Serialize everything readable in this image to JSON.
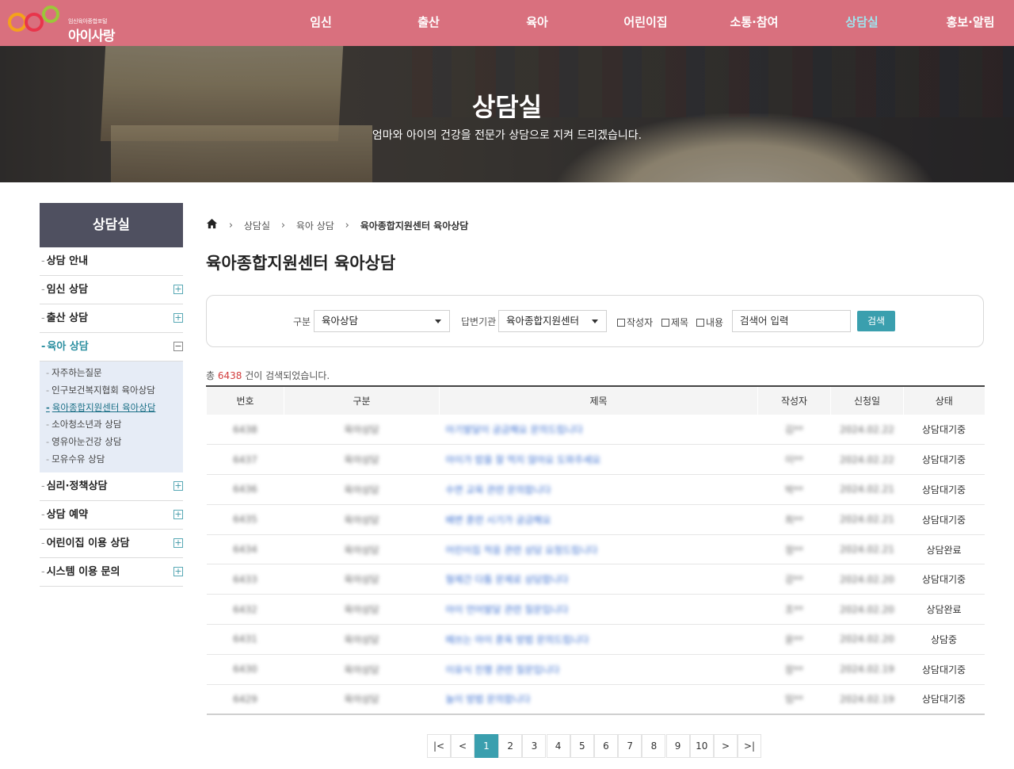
{
  "logo": {
    "sub": "임신육아종합포털",
    "main": "아이사랑"
  },
  "nav": [
    "임신",
    "출산",
    "육아",
    "어린이집",
    "소통·참여",
    "상담실",
    "홍보·알림"
  ],
  "hero": {
    "title": "상담실",
    "subtitle": "엄마와 아이의 건강을 전문가 상담으로 지켜 드리겠습니다."
  },
  "sidebar": {
    "title": "상담실",
    "items": [
      {
        "label": "상담 안내",
        "toggle": ""
      },
      {
        "label": "임신 상담",
        "toggle": "+"
      },
      {
        "label": "출산 상담",
        "toggle": "+"
      },
      {
        "label": "육아 상담",
        "toggle": "−"
      },
      {
        "label": "심리·정책상담",
        "toggle": "+"
      },
      {
        "label": "상담 예약",
        "toggle": "+"
      },
      {
        "label": "어린이집 이용 상담",
        "toggle": "+"
      },
      {
        "label": "시스템 이용 문의",
        "toggle": "+"
      }
    ],
    "sub_items": [
      "자주하는질문",
      "인구보건복지협회 육아상담",
      "육아종합지원센터 육아상담",
      "소아청소년과 상담",
      "영유아눈건강 상담",
      "모유수유 상담"
    ]
  },
  "breadcrumb": {
    "level1": "상담실",
    "level2": "육아 상담",
    "current": "육아종합지원센터 육아상담"
  },
  "page_title": "육아종합지원센터 육아상담",
  "search": {
    "category_label": "구분",
    "category_value": "육아상담",
    "agency_label": "답변기관",
    "agency_value": "육아종합지원센터",
    "checkbox_writer": "작성자",
    "checkbox_title": "제목",
    "checkbox_content": "내용",
    "keyword_placeholder": "검색어 입력",
    "button": "검색"
  },
  "result": {
    "prefix": "총",
    "count": "6438",
    "suffix": "건이 검색되었습니다."
  },
  "table": {
    "headers": [
      "번호",
      "구분",
      "제목",
      "작성자",
      "신청일",
      "상태"
    ],
    "rows": [
      {
        "no": "6438",
        "cat": "육아상담",
        "title": "아기발달이 궁금해요 문의드립니다",
        "writer": "김**",
        "date": "2024.02.22",
        "status": "상담대기중"
      },
      {
        "no": "6437",
        "cat": "육아상담",
        "title": "아이가 밥을 잘 먹지 않아요 도와주세요",
        "writer": "이**",
        "date": "2024.02.22",
        "status": "상담대기중"
      },
      {
        "no": "6436",
        "cat": "육아상담",
        "title": "수면 교육 관련 문의합니다",
        "writer": "박**",
        "date": "2024.02.21",
        "status": "상담대기중"
      },
      {
        "no": "6435",
        "cat": "육아상담",
        "title": "배변 훈련 시기가 궁금해요",
        "writer": "최**",
        "date": "2024.02.21",
        "status": "상담대기중"
      },
      {
        "no": "6434",
        "cat": "육아상담",
        "title": "어린이집 적응 관련 상담 요청드립니다",
        "writer": "정**",
        "date": "2024.02.21",
        "status": "상담완료"
      },
      {
        "no": "6433",
        "cat": "육아상담",
        "title": "형제간 다툼 문제로 상담합니다",
        "writer": "강**",
        "date": "2024.02.20",
        "status": "상담대기중"
      },
      {
        "no": "6432",
        "cat": "육아상담",
        "title": "아이 언어발달 관련 질문입니다",
        "writer": "조**",
        "date": "2024.02.20",
        "status": "상담완료"
      },
      {
        "no": "6431",
        "cat": "육아상담",
        "title": "떼쓰는 아이 훈육 방법 문의드립니다",
        "writer": "윤**",
        "date": "2024.02.20",
        "status": "상담중"
      },
      {
        "no": "6430",
        "cat": "육아상담",
        "title": "이유식 진행 관련 질문입니다",
        "writer": "장**",
        "date": "2024.02.19",
        "status": "상담대기중"
      },
      {
        "no": "6429",
        "cat": "육아상담",
        "title": "놀이 방법 문의합니다",
        "writer": "임**",
        "date": "2024.02.19",
        "status": "상담대기중"
      }
    ]
  },
  "pagination": {
    "first": "|<",
    "prev": "<",
    "pages": [
      "1",
      "2",
      "3",
      "4",
      "5",
      "6",
      "7",
      "8",
      "9",
      "10"
    ],
    "current": "1",
    "next": ">",
    "last": ">|"
  },
  "colors": {
    "header": "#d9707e",
    "accent": "#3a9fae",
    "sidebar_title": "#4f5060",
    "active_nav": "#9ee6f0"
  }
}
